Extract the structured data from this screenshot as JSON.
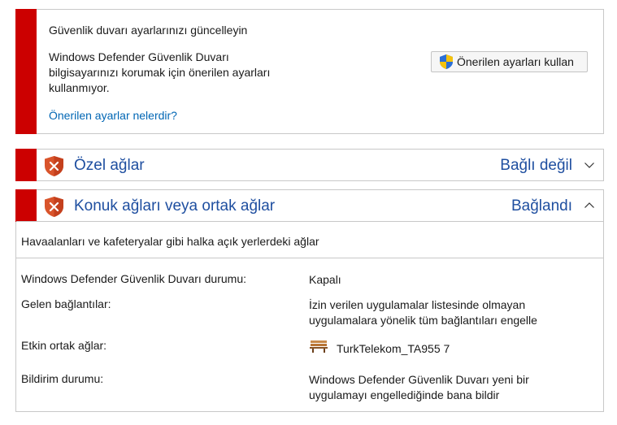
{
  "warning": {
    "title": "Güvenlik duvarı ayarlarınızı güncelleyin",
    "description": "Windows Defender Güvenlik Duvarı bilgisayarınızı korumak için önerilen ayarları kullanmıyor.",
    "link": "Önerilen ayarlar nelerdir?",
    "button_label": "Önerilen ayarları kullan",
    "button_icon": "uac-shield-icon",
    "accent_color": "#cc0000"
  },
  "private_network": {
    "name": "Özel ağlar",
    "status": "Bağlı değil",
    "expanded": false,
    "icon": "red-shield-x-icon"
  },
  "guest_network": {
    "name": "Konuk ağları veya ortak ağlar",
    "status": "Bağlandı",
    "expanded": true,
    "icon": "red-shield-x-icon",
    "description": "Havaalanları ve kafeteryalar gibi halka açık yerlerdeki ağlar",
    "details": {
      "firewall_state_label": "Windows Defender Güvenlik Duvarı durumu:",
      "firewall_state_value": "Kapalı",
      "incoming_label": "Gelen bağlantılar:",
      "incoming_value": "İzin verilen uygulamalar listesinde olmayan uygulamalara yönelik tüm bağlantıları engelle",
      "active_networks_label": "Etkin ortak ağlar:",
      "active_networks_value": "TurkTelekom_TA955 7",
      "active_networks_icon": "park-bench-icon",
      "notification_label": "Bildirim durumu:",
      "notification_value": "Windows Defender Güvenlik Duvarı yeni bir uygulamayı engellediğinde bana bildir"
    }
  },
  "colors": {
    "link": "#0066b4",
    "header_text": "#1f4fa0",
    "stripe": "#cc0000"
  }
}
